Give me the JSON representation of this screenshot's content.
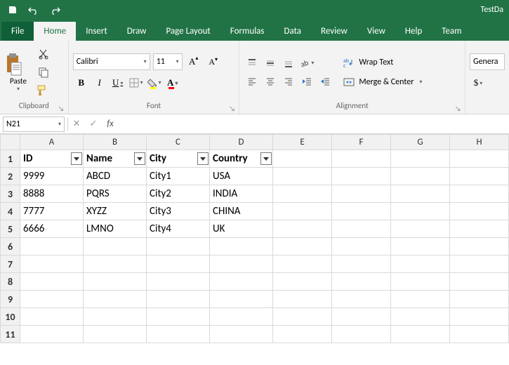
{
  "title": "TestDa",
  "tabs": {
    "file": "File",
    "home": "Home",
    "insert": "Insert",
    "draw": "Draw",
    "page_layout": "Page Layout",
    "formulas": "Formulas",
    "data": "Data",
    "review": "Review",
    "view": "View",
    "help": "Help",
    "team": "Team"
  },
  "ribbon": {
    "clipboard": {
      "paste": "Paste",
      "label": "Clipboard"
    },
    "font": {
      "name": "Calibri",
      "size": "11",
      "label": "Font"
    },
    "alignment": {
      "wrap": "Wrap Text",
      "merge": "Merge & Center",
      "label": "Alignment"
    },
    "number": {
      "format": "Genera",
      "label": ""
    }
  },
  "namebox": "N21",
  "formula": "",
  "fx_label": "fx",
  "columns": [
    "A",
    "B",
    "C",
    "D",
    "E",
    "F",
    "G",
    "H"
  ],
  "row_numbers": [
    "1",
    "2",
    "3",
    "4",
    "5",
    "6",
    "7",
    "8",
    "9",
    "10",
    "11"
  ],
  "table": {
    "headers": [
      "ID",
      "Name",
      "City",
      "Country"
    ],
    "rows": [
      [
        "9999",
        "ABCD",
        "City1",
        "USA"
      ],
      [
        "8888",
        "PQRS",
        "City2",
        "INDIA"
      ],
      [
        "7777",
        "XYZZ",
        "City3",
        "CHINA"
      ],
      [
        "6666",
        "LMNO",
        "City4",
        "UK"
      ]
    ]
  }
}
